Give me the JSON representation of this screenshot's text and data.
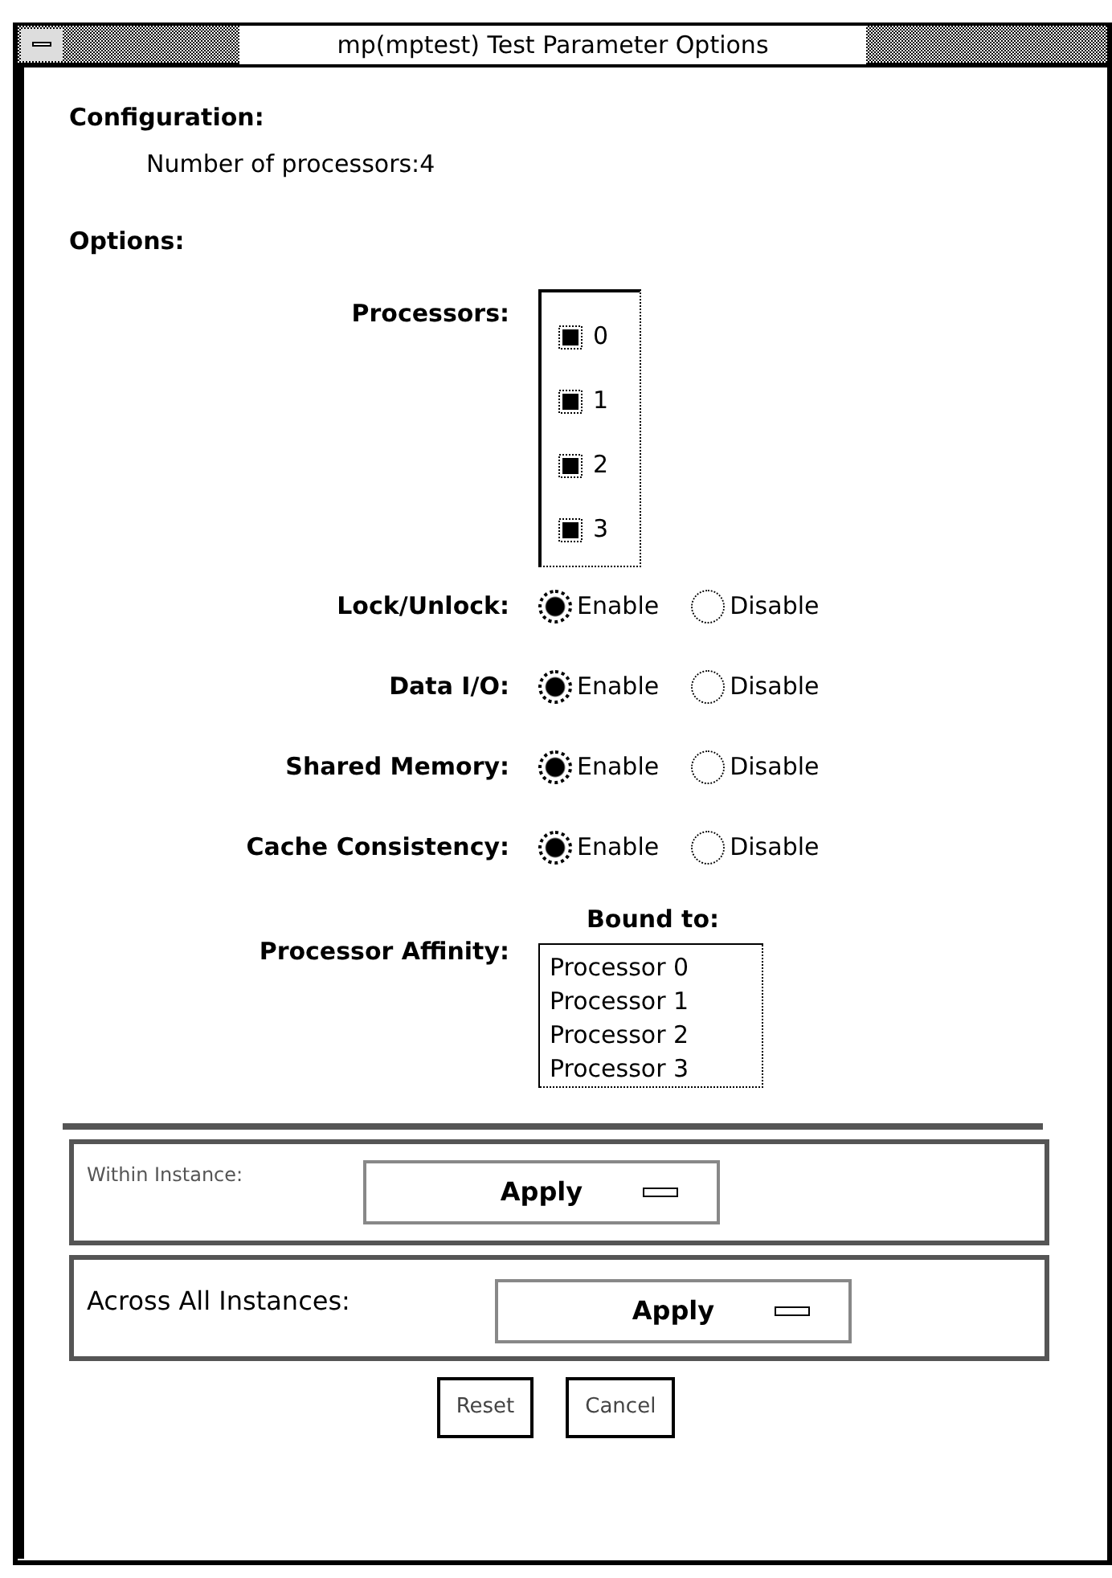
{
  "window": {
    "title": "mp(mptest) Test Parameter Options"
  },
  "configuration": {
    "heading": "Configuration:",
    "lines": [
      "Number of processors:4"
    ]
  },
  "options": {
    "heading": "Options:",
    "processors": {
      "label": "Processors:",
      "items": [
        {
          "label": "0",
          "checked": true
        },
        {
          "label": "1",
          "checked": true
        },
        {
          "label": "2",
          "checked": true
        },
        {
          "label": "3",
          "checked": true
        }
      ]
    },
    "toggles": [
      {
        "label": "Lock/Unlock:",
        "choices": [
          {
            "label": "Enable",
            "selected": true
          },
          {
            "label": "Disable",
            "selected": false
          }
        ]
      },
      {
        "label": "Data I/O:",
        "choices": [
          {
            "label": "Enable",
            "selected": true
          },
          {
            "label": "Disable",
            "selected": false
          }
        ]
      },
      {
        "label": "Shared Memory:",
        "choices": [
          {
            "label": "Enable",
            "selected": true
          },
          {
            "label": "Disable",
            "selected": false
          }
        ]
      },
      {
        "label": "Cache Consistency:",
        "choices": [
          {
            "label": "Enable",
            "selected": true
          },
          {
            "label": "Disable",
            "selected": false
          }
        ]
      }
    ],
    "affinity": {
      "label": "Processor Affinity:",
      "list_heading": "Bound to:",
      "items": [
        "Processor 0",
        "Processor 1",
        "Processor 2",
        "Processor 3"
      ]
    }
  },
  "apply_groups": [
    {
      "kind": "small",
      "label": "Within Instance:",
      "value": "Apply"
    },
    {
      "kind": "large",
      "label": "Across All Instances:",
      "value": "Apply"
    }
  ],
  "buttons": [
    "Reset",
    "Cancel"
  ]
}
